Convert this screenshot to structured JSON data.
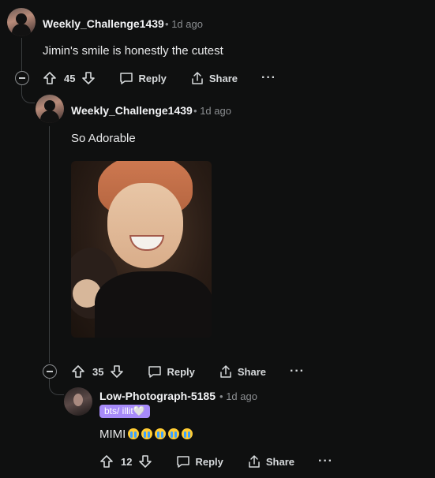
{
  "comments": [
    {
      "username": "Weekly_Challenge1439",
      "time": "1d ago",
      "text": "Jimin's smile is honestly the cutest",
      "votes": "45",
      "reply_label": "Reply",
      "share_label": "Share",
      "more_label": "···"
    },
    {
      "username": "Weekly_Challenge1439",
      "time": "1d ago",
      "text": "So Adorable",
      "votes": "35",
      "reply_label": "Reply",
      "share_label": "Share",
      "more_label": "···"
    },
    {
      "username": "Low-Photograph-5185",
      "time": "1d ago",
      "flair": "bts/ illit🤍",
      "text": "MIMI",
      "emoji_count": 5,
      "votes": "12",
      "reply_label": "Reply",
      "share_label": "Share",
      "more_label": "···"
    }
  ],
  "separator": "•",
  "colors": {
    "background": "#0f1010",
    "flair": "#a78bfa",
    "text": "#d7dadc"
  }
}
